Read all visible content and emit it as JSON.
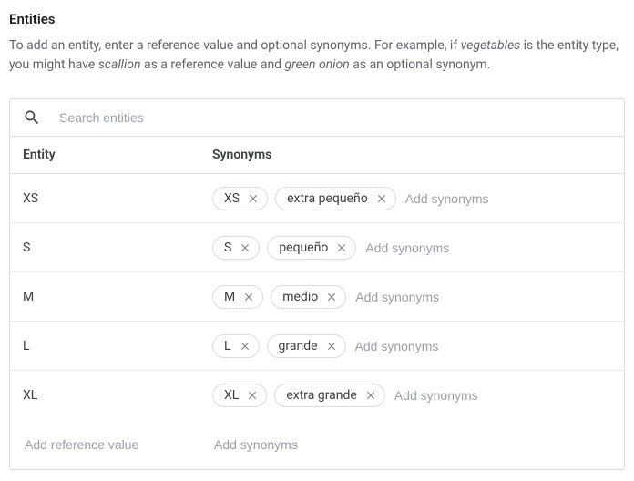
{
  "title": "Entities",
  "description": {
    "pre1": "To add an entity, enter a reference value and optional synonyms. For example, if ",
    "em1": "vegetables",
    "mid1": " is the entity type, you might have ",
    "em2": "scallion",
    "mid2": " as a reference value and ",
    "em3": "green onion",
    "post": " as an optional synonym."
  },
  "search": {
    "placeholder": "Search entities"
  },
  "columns": {
    "entity": "Entity",
    "synonyms": "Synonyms"
  },
  "rows": [
    {
      "ref": "XS",
      "synonyms": [
        "XS",
        "extra pequeño"
      ]
    },
    {
      "ref": "S",
      "synonyms": [
        "S",
        "pequeño"
      ]
    },
    {
      "ref": "M",
      "synonyms": [
        "M",
        "medio"
      ]
    },
    {
      "ref": "L",
      "synonyms": [
        "L",
        "grande"
      ]
    },
    {
      "ref": "XL",
      "synonyms": [
        "XL",
        "extra grande"
      ]
    }
  ],
  "placeholders": {
    "add_synonyms": "Add synonyms",
    "add_reference": "Add reference value"
  }
}
